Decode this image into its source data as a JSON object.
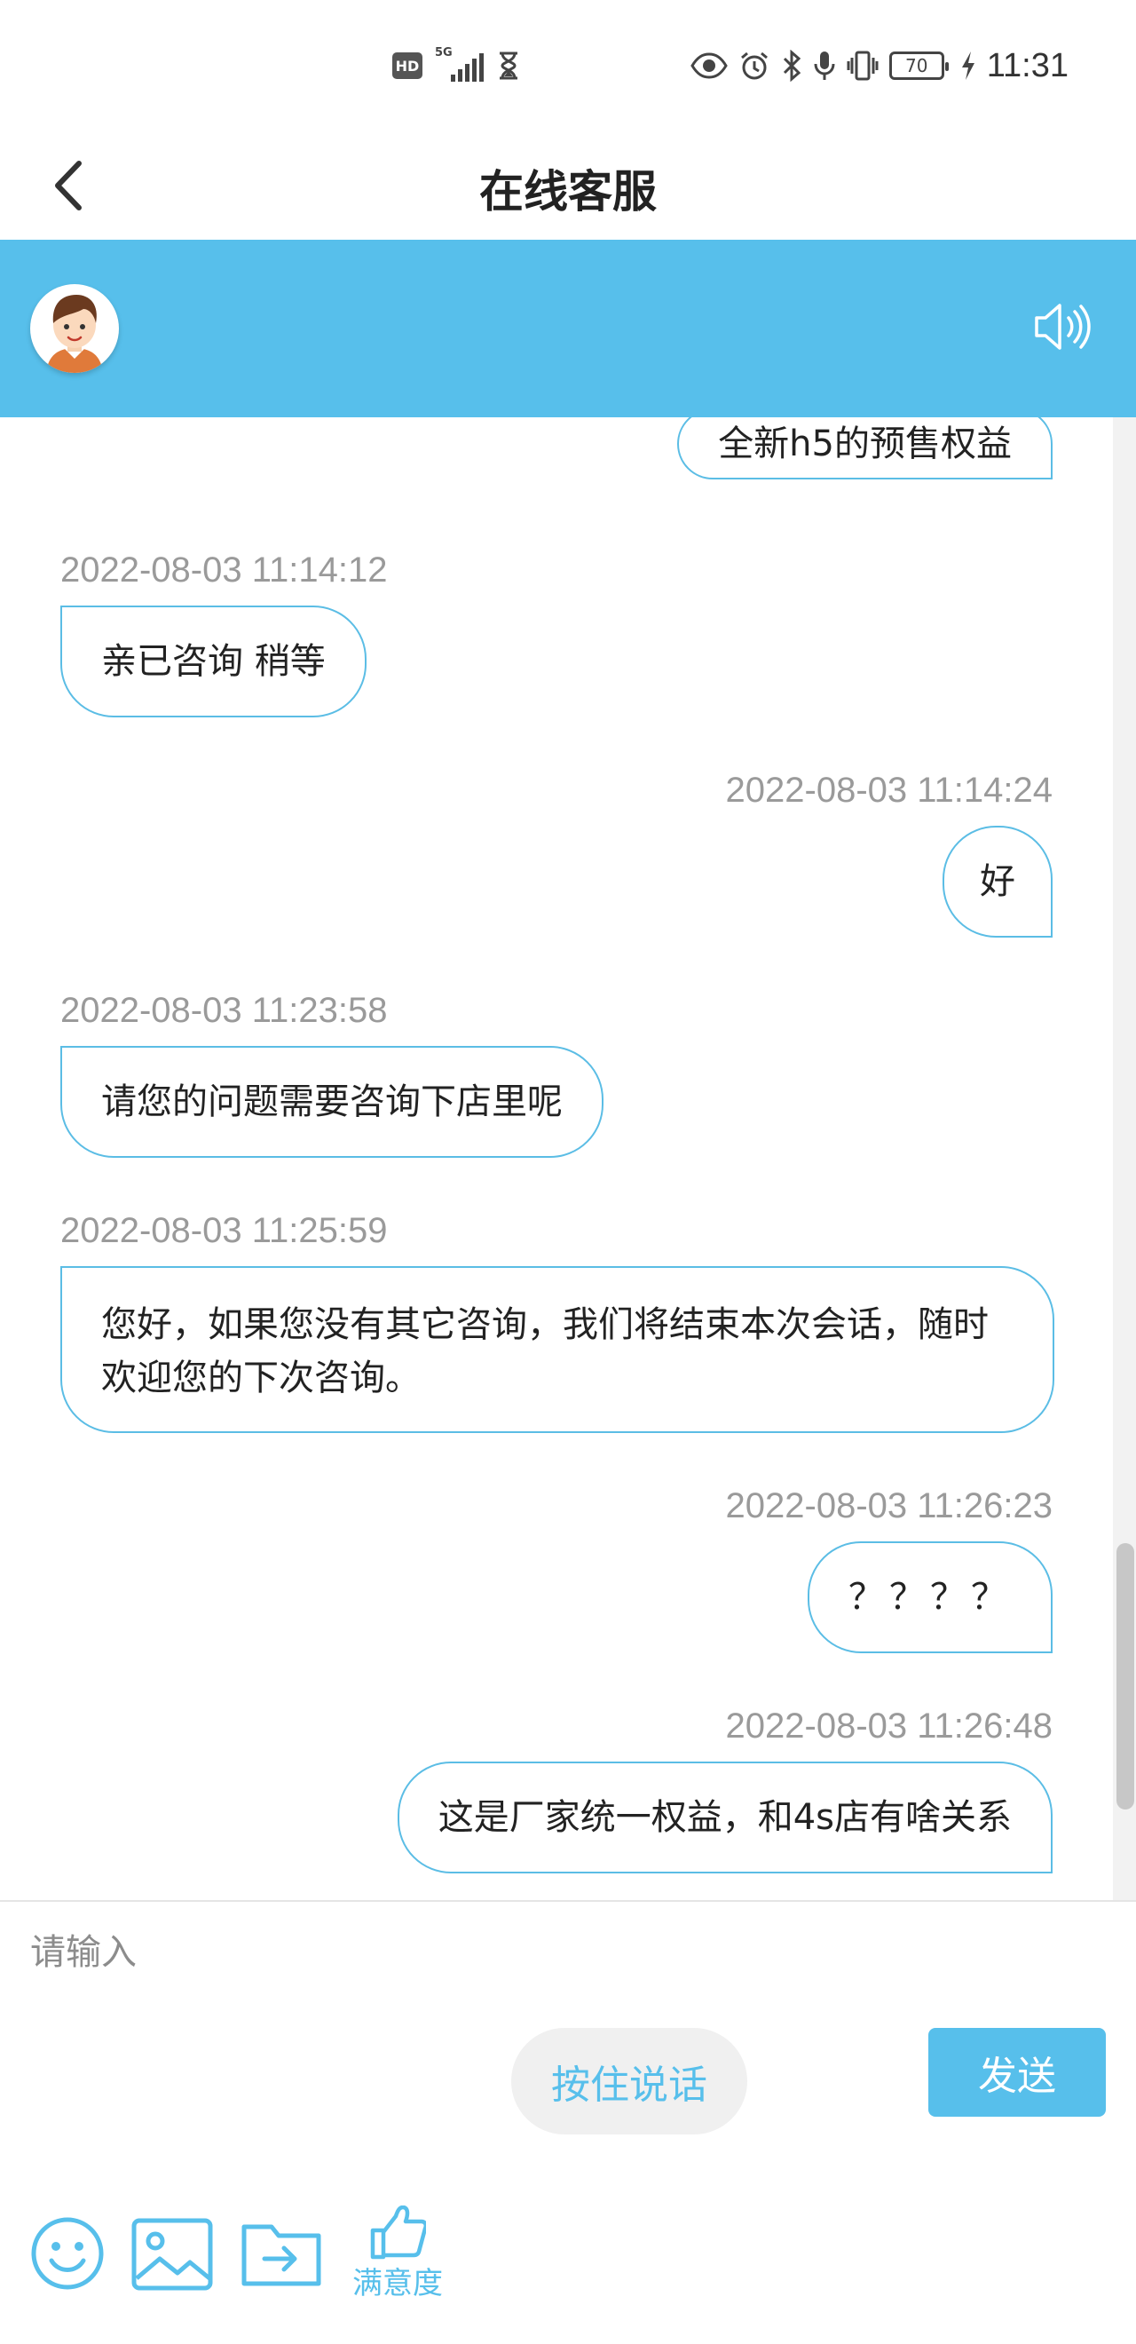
{
  "status_bar": {
    "hd": "HD",
    "network": "5G",
    "battery": "70",
    "time": "11:31",
    "icons": [
      "hd-icon",
      "signal-icon",
      "hourglass-icon",
      "eye-icon",
      "alarm-icon",
      "bluetooth-icon",
      "mic-icon",
      "vibrate-icon",
      "battery-icon",
      "charging-icon"
    ]
  },
  "header": {
    "title": "在线客服",
    "back_icon": "chevron-left-icon"
  },
  "agent_bar": {
    "background": "#57bfeb",
    "avatar_icon": "agent-avatar-icon",
    "speaker_icon": "speaker-icon"
  },
  "messages": [
    {
      "from": "user",
      "time": "",
      "text": "全新h5的预售权益"
    },
    {
      "from": "agent",
      "time": "2022-08-03 11:14:12",
      "text": "亲已咨询 稍等"
    },
    {
      "from": "user",
      "time": "2022-08-03 11:14:24",
      "text": "好"
    },
    {
      "from": "agent",
      "time": "2022-08-03 11:23:58",
      "text": "请您的问题需要咨询下店里呢"
    },
    {
      "from": "agent",
      "time": "2022-08-03 11:25:59",
      "text": "您好，如果您没有其它咨询，我们将结束本次会话，随时欢迎您的下次咨询。"
    },
    {
      "from": "user",
      "time": "2022-08-03 11:26:23",
      "text": "？？？？"
    },
    {
      "from": "user",
      "time": "2022-08-03 11:26:48",
      "text": "这是厂家统一权益，和4s店有啥关系"
    }
  ],
  "composer": {
    "placeholder": "请输入",
    "rate_label": "满意度",
    "voice_label": "按住说话",
    "send_label": "发送",
    "accent": "#57bfeb"
  }
}
